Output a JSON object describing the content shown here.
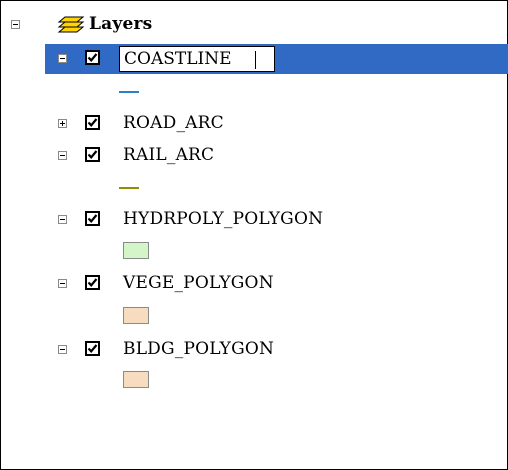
{
  "toc": {
    "root_label": "Layers",
    "editing_text": "COASTLINE",
    "layers": [
      {
        "name": "COASTLINE",
        "checked": true,
        "expanded": true,
        "symbol": "line",
        "color": "#2f7fc6"
      },
      {
        "name": "ROAD_ARC",
        "checked": true,
        "expanded": false
      },
      {
        "name": "RAIL_ARC",
        "checked": true,
        "expanded": true,
        "symbol": "line",
        "color": "#8f8f00"
      },
      {
        "name": "HYDRPOLY_POLYGON",
        "checked": true,
        "expanded": true,
        "symbol": "fill",
        "color": "#d4f5c8"
      },
      {
        "name": "VEGE_POLYGON",
        "checked": true,
        "expanded": true,
        "symbol": "fill",
        "color": "#f8dcc0"
      },
      {
        "name": "BLDG_POLYGON",
        "checked": true,
        "expanded": true,
        "symbol": "fill",
        "color": "#f8dcc0"
      }
    ],
    "colors": {
      "selection": "#316ac5",
      "layers_icon": "#ffd400"
    }
  }
}
